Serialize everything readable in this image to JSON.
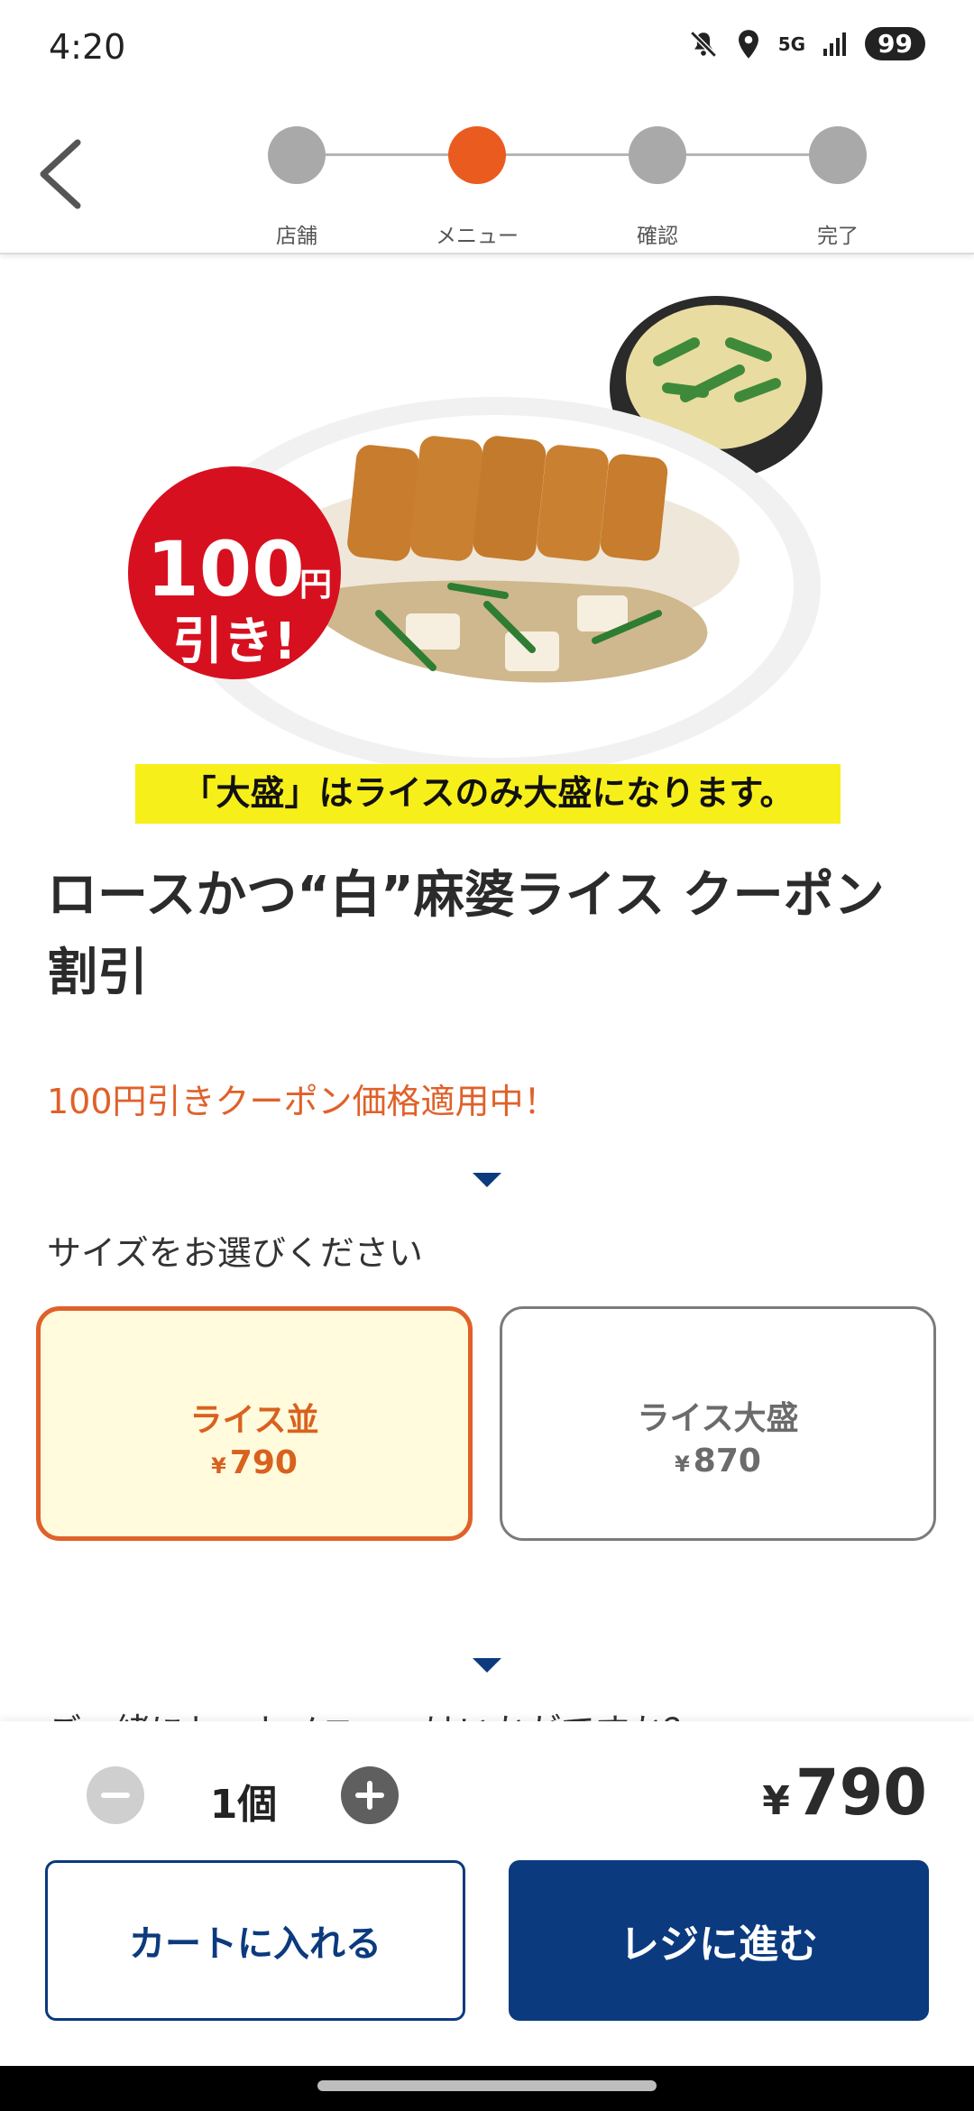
{
  "status_bar": {
    "time": "4:20",
    "network": "5G",
    "battery": "99",
    "icons": [
      "mute-icon",
      "location-icon",
      "signal-icon"
    ]
  },
  "header": {
    "back_icon": "chevron-left-icon",
    "steps": [
      {
        "label": "店舗",
        "active": false
      },
      {
        "label": "メニュー",
        "active": true
      },
      {
        "label": "確認",
        "active": false
      },
      {
        "label": "完了",
        "active": false
      }
    ]
  },
  "product": {
    "image_badge": {
      "line1": "100",
      "line1_unit": "円",
      "line2": "引き!"
    },
    "image_banner": "「大盛」はライスのみ大盛になります。",
    "title": "ロースかつ“白”麻婆ライス クーポン割引",
    "coupon_note": "100円引きクーポン価格適用中！"
  },
  "size_section": {
    "heading": "サイズをお選びください",
    "options": [
      {
        "name": "ライス並",
        "currency": "¥",
        "price": "790",
        "selected": true
      },
      {
        "name": "ライス大盛",
        "currency": "¥",
        "price": "870",
        "selected": false
      }
    ]
  },
  "next_section_peek": "ご一緒にセットメニューはいかがですか？",
  "order": {
    "quantity": "1個",
    "currency": "¥",
    "total": "790",
    "add_to_cart_label": "カートに入れる",
    "checkout_label": "レジに進む"
  },
  "colors": {
    "accent": "#ea5b1f",
    "primary_navy": "#0b3a7e",
    "selected_bg": "#fffbdc",
    "inactive_step": "#a9a9a9"
  }
}
